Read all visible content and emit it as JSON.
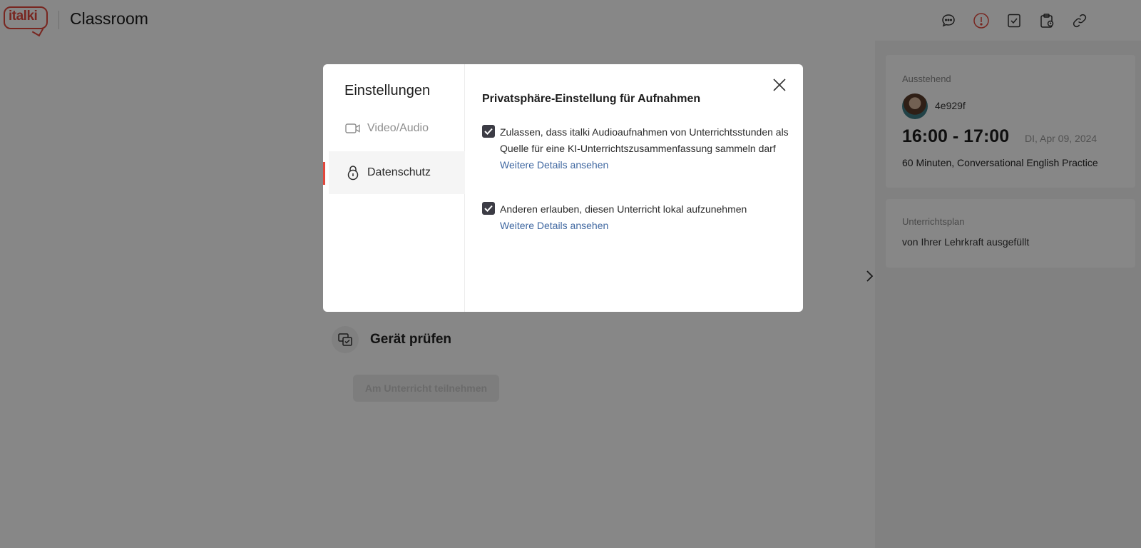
{
  "header": {
    "logo_text": "italki",
    "title": "Classroom"
  },
  "main": {
    "device_check_label": "Gerät prüfen",
    "join_button_label": "Am Unterricht teilnehmen"
  },
  "toolbar": {
    "icons": [
      "chat-icon",
      "info-icon",
      "notes-icon",
      "clipboard-icon",
      "link-icon"
    ]
  },
  "lesson": {
    "status": "Ausstehend",
    "teacher_name": "4e929f",
    "time_range": "16:00 - 17:00",
    "date": "DI, Apr 09, 2024",
    "description": "60 Minuten, Conversational English Practice"
  },
  "plan": {
    "title": "Unterrichtsplan",
    "status": "von Ihrer Lehrkraft ausgefüllt"
  },
  "modal": {
    "title": "Einstellungen",
    "nav": {
      "video_audio": "Video/Audio",
      "privacy": "Datenschutz"
    },
    "section_title": "Privatsphäre-Einstellung für Aufnahmen",
    "options": [
      {
        "text": "Zulassen, dass italki Audioaufnahmen von Unterrichtsstunden als Quelle für eine KI-Unterrichtszusammenfassung sammeln darf",
        "link": "Weitere Details ansehen",
        "checked": true
      },
      {
        "text": "Anderen erlauben, diesen Unterricht lokal aufzunehmen",
        "link": "Weitere Details ansehen",
        "checked": true
      }
    ]
  },
  "colors": {
    "brand": "#e2483d",
    "link": "#3f67a0",
    "checkbox": "#3c3c45"
  }
}
